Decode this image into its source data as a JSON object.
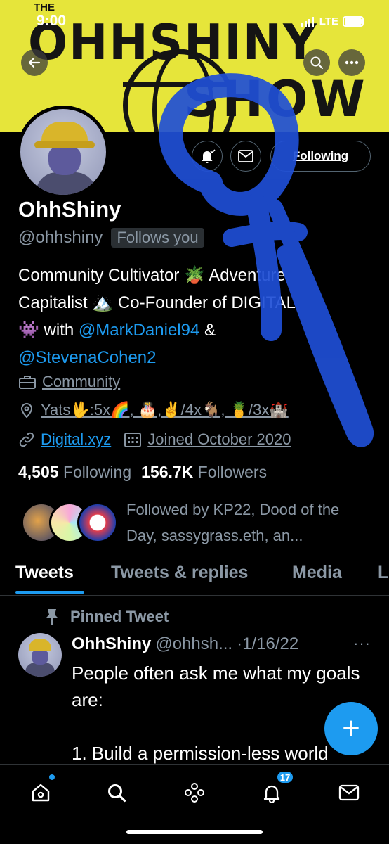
{
  "status_bar": {
    "time": "9:00",
    "network": "LTE"
  },
  "banner": {
    "top_text": "THE",
    "title": "OHHSHINY",
    "subtitle": "SHOW"
  },
  "profile": {
    "name": "OhhShiny",
    "handle": "@ohhshiny",
    "follows_you": "Follows you",
    "following_button": "Following",
    "bio": {
      "line1": "Community Cultivator 🪴 Adventure",
      "line2": "Capitalist 🏔️ Co-Founder of DIGITAL",
      "line3_prefix": "👾 with ",
      "mention1": "@MarkDaniel94",
      "line3_suffix": " &",
      "mention2": "@StevenaCohen2"
    },
    "category": "Community",
    "location": "Yats🖖:5x🌈, 🎂,✌️/4x🐐, 🍍/3x🏰",
    "website": "Digital.xyz",
    "joined": "Joined October 2020",
    "following_count": "4,505",
    "following_label": "Following",
    "followers_count": "156.7K",
    "followers_label": "Followers",
    "followed_by": "Followed by KP22, Dood of the Day, sassygrass.eth, an..."
  },
  "tabs": [
    "Tweets",
    "Tweets & replies",
    "Media",
    "Likes"
  ],
  "tweet": {
    "pinned_label": "Pinned Tweet",
    "author": "OhhShiny",
    "handle": "@ohhsh...",
    "date": "·1/16/22",
    "more": "···",
    "body": "People often ask me what my goals are:\n\n1. Build a permission-less world"
  },
  "fab": {
    "label": "+"
  },
  "bottom_nav": {
    "notifications_badge": "17"
  },
  "colors": {
    "accent": "#1d9bf0",
    "background": "#000000",
    "banner": "#e6e53a"
  },
  "icons": [
    "back-arrow-icon",
    "search-icon",
    "more-icon",
    "bell-icon",
    "mail-icon",
    "briefcase-icon",
    "location-icon",
    "link-icon",
    "calendar-icon",
    "pin-icon",
    "home-icon",
    "spaces-icon",
    "plus-icon"
  ]
}
